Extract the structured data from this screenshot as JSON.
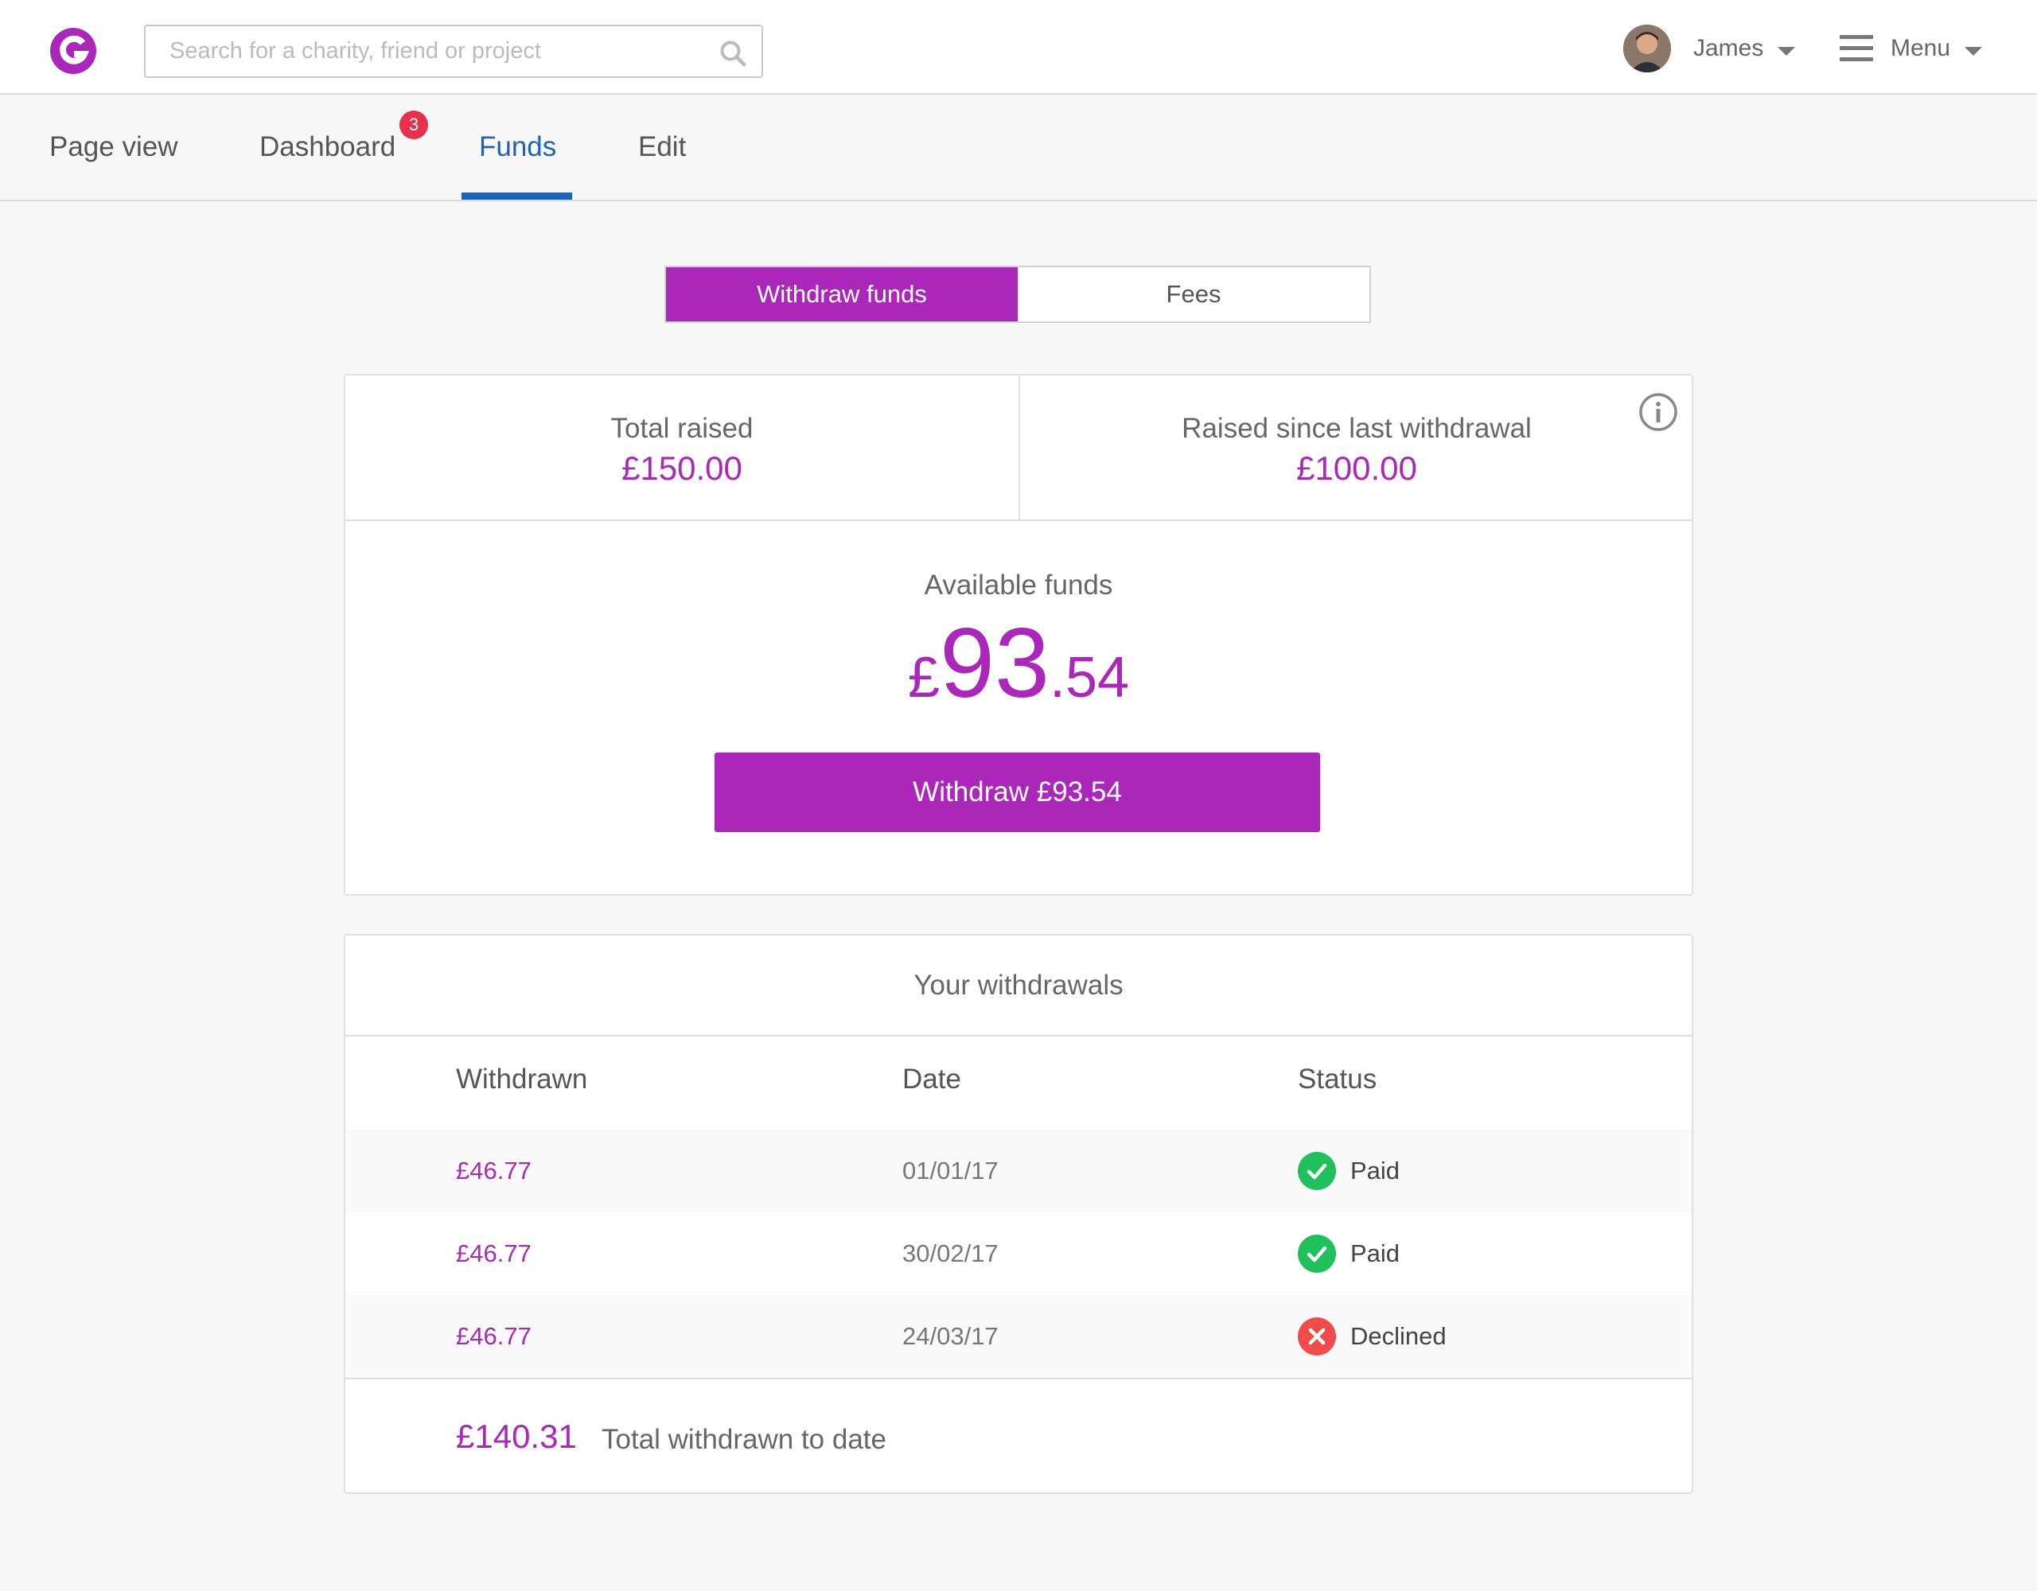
{
  "header": {
    "search_placeholder": "Search for a charity, friend or project",
    "user_name": "James",
    "menu_label": "Menu"
  },
  "tabs": [
    {
      "label": "Page view"
    },
    {
      "label": "Dashboard",
      "badge": "3"
    },
    {
      "label": "Funds",
      "active": true
    },
    {
      "label": "Edit"
    }
  ],
  "toggle": {
    "withdraw_label": "Withdraw funds",
    "fees_label": "Fees"
  },
  "summary": {
    "total_raised_label": "Total raised",
    "total_raised_value": "£150.00",
    "since_last_label": "Raised since last withdrawal",
    "since_last_value": "£100.00",
    "available_label": "Available funds",
    "available_currency": "£",
    "available_whole": "93",
    "available_decimal": ".54",
    "withdraw_button": "Withdraw £93.54"
  },
  "withdrawals": {
    "title": "Your withdrawals",
    "headers": {
      "withdrawn": "Withdrawn",
      "date": "Date",
      "status": "Status"
    },
    "rows": [
      {
        "amount": "£46.77",
        "date": "01/01/17",
        "status": "Paid"
      },
      {
        "amount": "£46.77",
        "date": "30/02/17",
        "status": "Paid"
      },
      {
        "amount": "£46.77",
        "date": "24/03/17",
        "status": "Declined"
      }
    ],
    "total_amount": "£140.31",
    "total_label": "Total withdrawn to date"
  },
  "colors": {
    "brand": "#ab27b9",
    "active_tab": "#1e63b8",
    "paid": "#20c05c",
    "declined": "#f04c4c",
    "badge": "#e9304a"
  },
  "icons": {
    "logo": "giving-logo-icon",
    "search": "search-icon",
    "info": "info-icon",
    "paid": "check-circle-icon",
    "declined": "cross-circle-icon"
  }
}
